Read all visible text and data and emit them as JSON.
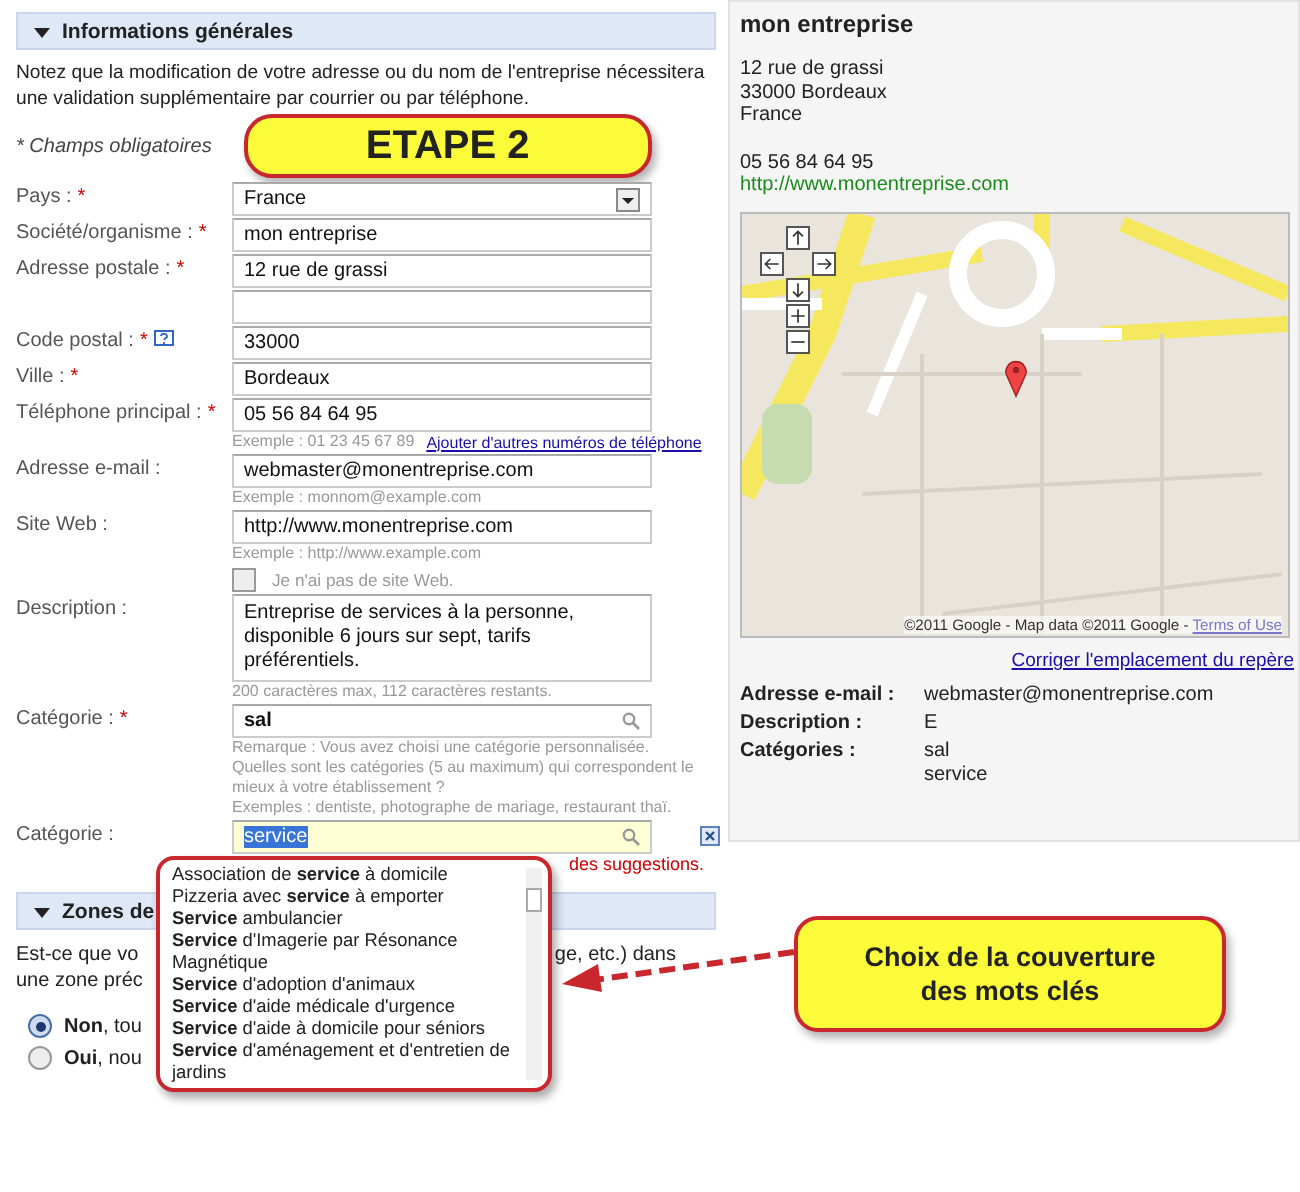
{
  "general": {
    "title": "Informations générales",
    "expanded": true,
    "notice": "Notez que la modification de votre adresse ou du nom de l'entreprise nécessitera une validation supplémentaire par courrier ou par téléphone.",
    "required_note": "* Champs obligatoires",
    "fields": [
      {
        "kind": "select",
        "label": "Pays :",
        "required_mark": "*",
        "value": "France"
      },
      {
        "kind": "text",
        "label": "Société/organisme :",
        "required_mark": "*",
        "value": "mon entreprise"
      },
      {
        "kind": "text",
        "label": "Adresse postale :",
        "required_mark": "*",
        "value": "12 rue de grassi"
      },
      {
        "kind": "text"
      },
      {
        "kind": "text",
        "label": "Code postal :",
        "required_mark": "*",
        "help": true,
        "value": "33000"
      },
      {
        "kind": "text",
        "label": "Ville :",
        "required_mark": "*",
        "value": "Bordeaux"
      },
      {
        "kind": "text",
        "label": "Téléphone principal :",
        "required_mark": "*",
        "value": "05 56 84 64 95",
        "hint": "Exemple : 01 23 45 67 89",
        "link": "Ajouter d'autres numéros de téléphone"
      },
      {
        "kind": "text",
        "label": "Adresse e-mail :",
        "value": "webmaster@monentreprise.com",
        "hint": "Exemple : monnom@example.com"
      },
      {
        "kind": "text",
        "label": "Site Web :",
        "value": "http://www.monentreprise.com",
        "hint": "Exemple : http://www.example.com",
        "checkbox": {
          "label": "Je n'ai pas de site Web.",
          "checked": false
        }
      },
      {
        "kind": "textarea",
        "label": "Description :",
        "value": "Entreprise de services à la personne, disponible 6 jours sur sept, tarifs préférentiels.",
        "hint": "200 caractères max, 112 caractères restants."
      },
      {
        "kind": "search",
        "label": "Catégorie :",
        "required_mark": "*",
        "value": "sal",
        "notes": [
          "Remarque : Vous avez choisi une catégorie personnalisée.",
          "Quelles sont les catégories (5 au maximum) qui correspondent le mieux à votre établissement ?",
          "Exemples : dentiste, photographe de mariage, restaurant thaï."
        ]
      },
      {
        "kind": "search",
        "label": "Catégorie :",
        "value": "service",
        "focused": true,
        "text_selected": true,
        "removable": true,
        "error": "des suggestions.",
        "suggestions": [
          "Association de **service** à domicile",
          "Pizzeria avec **service** à emporter",
          "**Service** ambulancier",
          "**Service** d'Imagerie par Résonance Magnétique",
          "**Service** d'adoption d'animaux",
          "**Service** d'aide médicale d'urgence",
          "**Service** d'aide à domicile pour séniors",
          "**Service** d'aménagement et d'entretien de jardins"
        ]
      }
    ]
  },
  "zones": {
    "title": "Zones de",
    "expanded": true,
    "question_lines": [
      [
        "Est-ce que vo",
        "ge, etc.) dans"
      ],
      [
        "une zone préc"
      ]
    ],
    "options": [
      {
        "label": "**Non**, tou",
        "selected": true
      },
      {
        "label": "**Oui**, nou",
        "selected": false
      }
    ]
  },
  "preview": {
    "name": "mon entreprise",
    "address_lines": [
      "12 rue de grassi",
      "33000 Bordeaux",
      "France"
    ],
    "phone": "05 56 84 64 95",
    "website": "http://www.monentreprise.com",
    "map": {
      "attribution": "©2011 Google - Map data ©2011 Google - ",
      "terms_link": "Terms of Use"
    },
    "correct_link": "Corriger l'emplacement du repère",
    "details": [
      {
        "label": "Adresse e-mail :",
        "values": [
          "webmaster@monentreprise.com"
        ]
      },
      {
        "label": "Description :",
        "values": [
          "E"
        ]
      },
      {
        "label": "Catégories :",
        "values": [
          "sal",
          "service"
        ]
      }
    ]
  },
  "callouts": [
    {
      "kind": "step",
      "text": "ETAPE 2"
    },
    {
      "kind": "note",
      "text": "Choix de la couverture des mots clés"
    }
  ]
}
